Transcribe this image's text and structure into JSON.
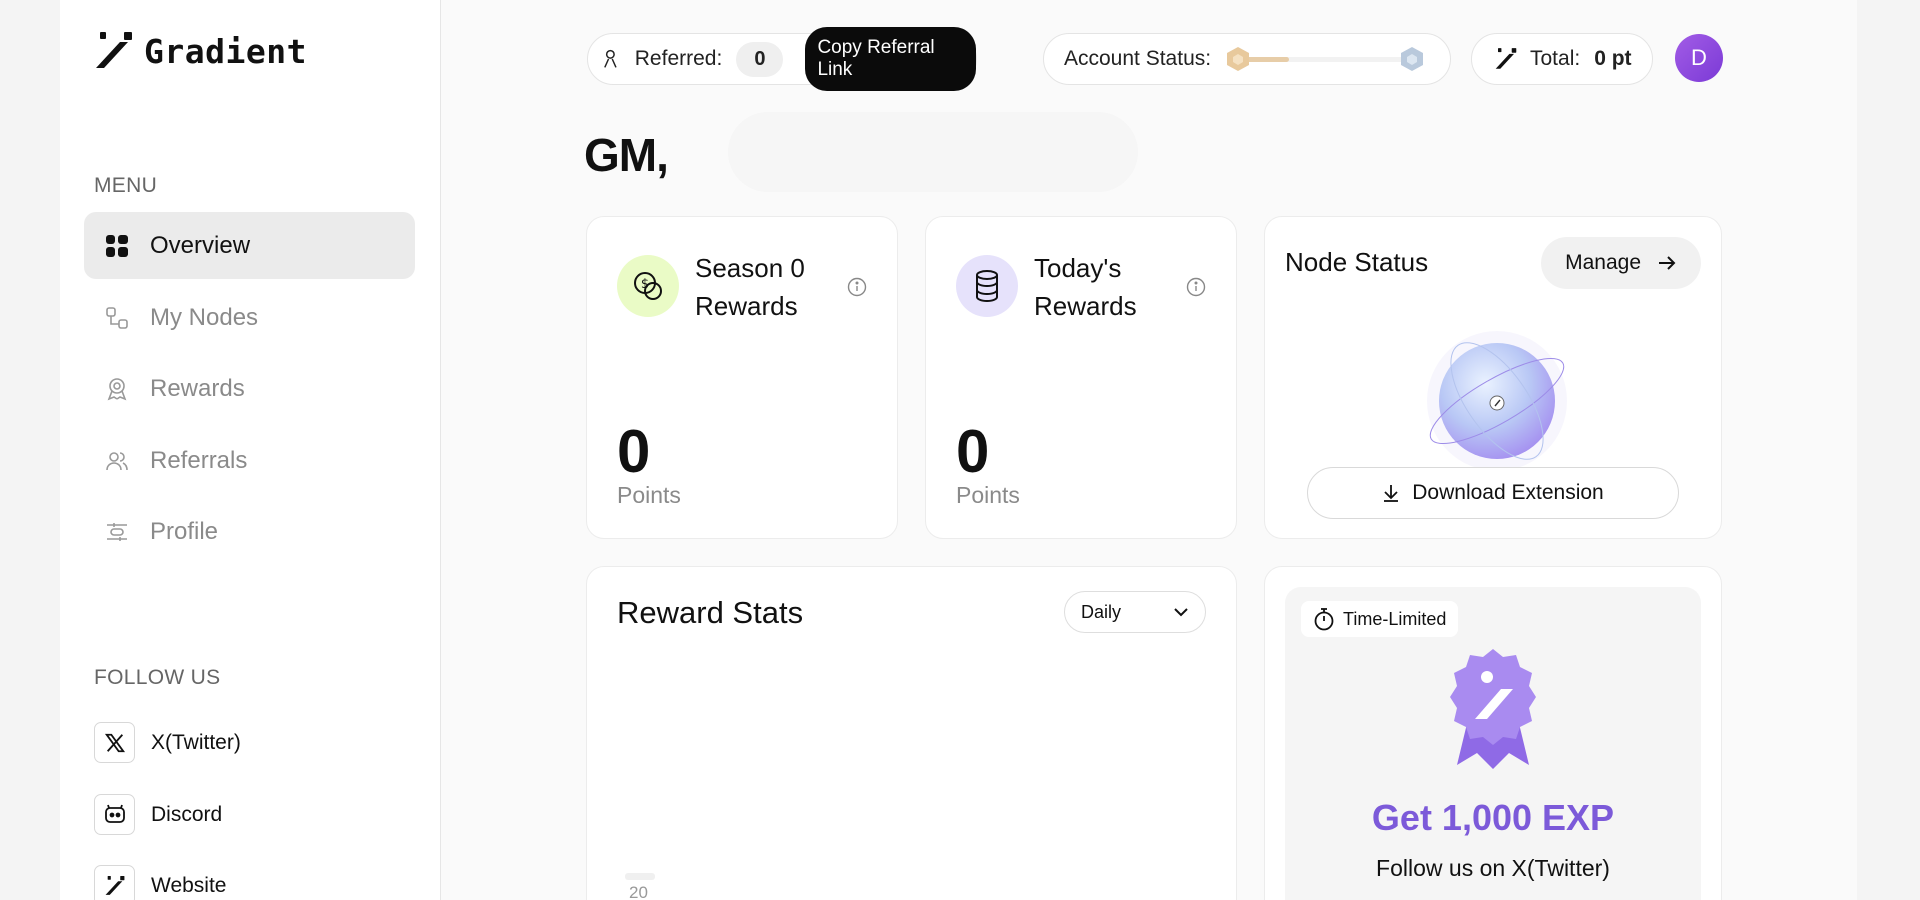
{
  "brand": {
    "name": "Gradient"
  },
  "sidebar": {
    "menu_label": "MENU",
    "items": [
      {
        "label": "Overview",
        "icon": "grid-icon",
        "active": true
      },
      {
        "label": "My Nodes",
        "icon": "nodes-icon",
        "active": false
      },
      {
        "label": "Rewards",
        "icon": "award-icon",
        "active": false
      },
      {
        "label": "Referrals",
        "icon": "users-icon",
        "active": false
      },
      {
        "label": "Profile",
        "icon": "sliders-icon",
        "active": false
      }
    ],
    "follow_label": "FOLLOW US",
    "follow": [
      {
        "label": "X(Twitter)",
        "icon": "x-icon"
      },
      {
        "label": "Discord",
        "icon": "discord-icon"
      },
      {
        "label": "Website",
        "icon": "gradient-logo-icon"
      }
    ]
  },
  "topbar": {
    "referred_label": "Referred:",
    "referred_count": "0",
    "copy_label": "Copy Referral Link",
    "account_status_label": "Account Status:",
    "account_status_progress": 0.3,
    "total_label": "Total:",
    "total_value": "0 pt",
    "avatar_initial": "D"
  },
  "greeting": "GM,",
  "cards": {
    "season": {
      "title": "Season 0 Rewards",
      "value": "0",
      "unit": "Points"
    },
    "today": {
      "title": "Today's Rewards",
      "value": "0",
      "unit": "Points"
    },
    "node": {
      "title": "Node Status",
      "manage_label": "Manage",
      "download_label": "Download Extension"
    }
  },
  "stats": {
    "title": "Reward Stats",
    "period": "Daily",
    "tick": "20"
  },
  "promo": {
    "badge": "Time-Limited",
    "headline": "Get 1,000 EXP",
    "sub": "Follow us on X(Twitter)"
  },
  "colors": {
    "accent": "#7c5ad9",
    "season_icon_bg": "#eafbc6",
    "today_icon_bg": "#e6e2fb",
    "status_fill": "#e7cda8"
  }
}
